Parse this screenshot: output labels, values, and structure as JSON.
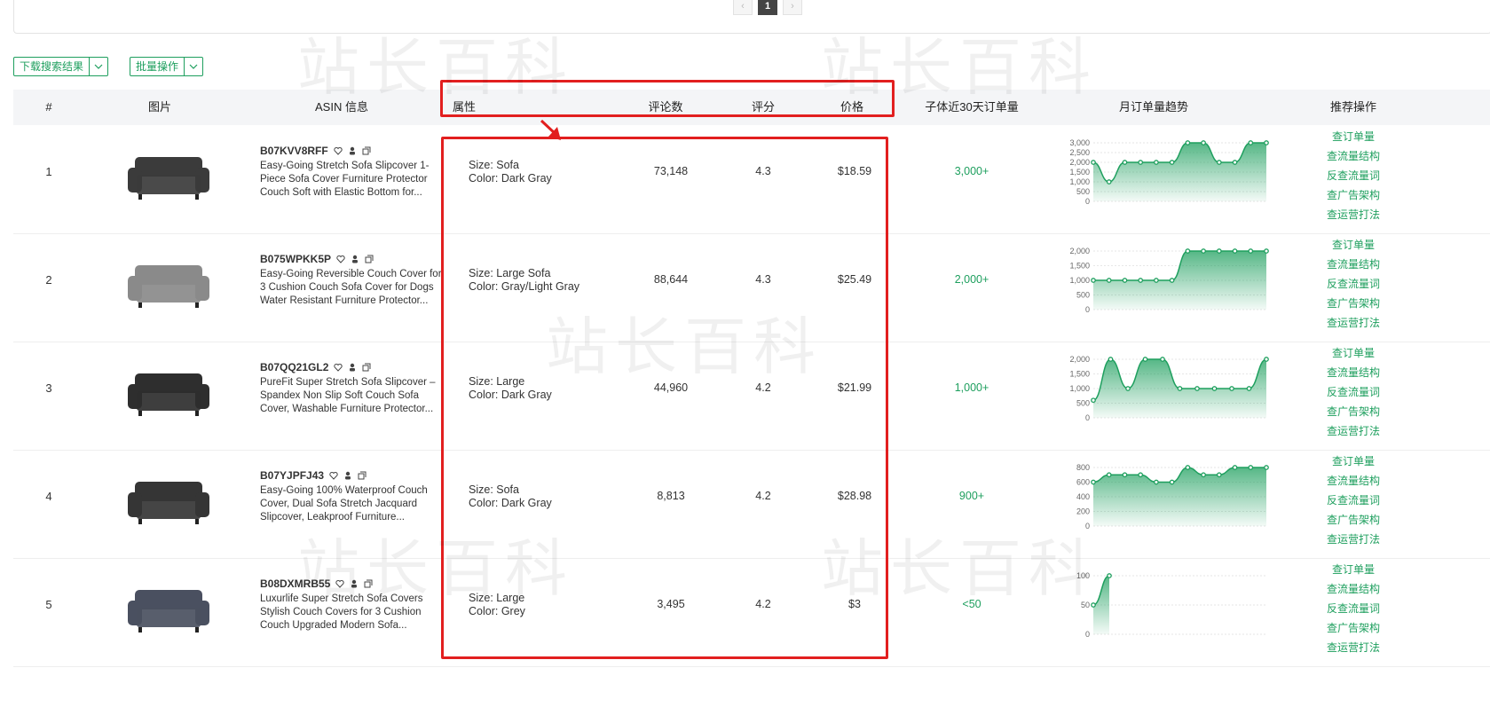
{
  "pager": {
    "prev": "‹",
    "current": "1",
    "next": "›"
  },
  "toolbar": {
    "download_label": "下载搜索结果",
    "batch_label": "批量操作"
  },
  "table": {
    "headers": {
      "index": "#",
      "image": "图片",
      "asin": "ASIN 信息",
      "attributes": "属性",
      "reviews": "评论数",
      "rating": "评分",
      "price": "价格",
      "orders": "子体近30天订单量",
      "trend": "月订单量趋势",
      "actions": "推荐操作"
    },
    "rows": [
      {
        "index": "1",
        "asin": "B07KVV8RFF",
        "title1": "Easy-Going Stretch Sofa Slipcover 1-",
        "title2": "Piece Sofa Cover Furniture Protector",
        "title3": "Couch Soft with Elastic Bottom for...",
        "size": "Size: Sofa",
        "color": "Color: Dark Gray",
        "reviews": "73,148",
        "rating": "4.3",
        "price": "$18.59",
        "orders": "3,000+",
        "trend": {
          "yticks": [
            "3,000",
            "2,500",
            "2,000",
            "1,500",
            "1,000",
            "500",
            "0"
          ],
          "ymax": 3000,
          "values": [
            2000,
            1000,
            2000,
            2000,
            2000,
            2000,
            3000,
            3000,
            2000,
            2000,
            3000,
            3000
          ]
        }
      },
      {
        "index": "2",
        "asin": "B075WPKK5P",
        "title1": "Easy-Going Reversible Couch Cover for",
        "title2": "3 Cushion Couch Sofa Cover for Dogs",
        "title3": "Water Resistant Furniture Protector...",
        "size": "Size: Large Sofa",
        "color": "Color: Gray/Light Gray",
        "reviews": "88,644",
        "rating": "4.3",
        "price": "$25.49",
        "orders": "2,000+",
        "trend": {
          "yticks": [
            "2,000",
            "1,500",
            "1,000",
            "500",
            "0"
          ],
          "ymax": 2000,
          "values": [
            1000,
            1000,
            1000,
            1000,
            1000,
            1000,
            2000,
            2000,
            2000,
            2000,
            2000,
            2000
          ]
        }
      },
      {
        "index": "3",
        "asin": "B07QQ21GL2",
        "title1": "PureFit Super Stretch Sofa Slipcover –",
        "title2": "Spandex Non Slip Soft Couch Sofa",
        "title3": "Cover, Washable Furniture Protector...",
        "size": "Size: Large",
        "color": "Color: Dark Gray",
        "reviews": "44,960",
        "rating": "4.2",
        "price": "$21.99",
        "orders": "1,000+",
        "trend": {
          "yticks": [
            "2,000",
            "1,500",
            "1,000",
            "500",
            "0"
          ],
          "ymax": 2000,
          "values": [
            600,
            2000,
            1000,
            2000,
            2000,
            1000,
            1000,
            1000,
            1000,
            1000,
            2000
          ]
        }
      },
      {
        "index": "4",
        "asin": "B07YJPFJ43",
        "title1": "Easy-Going 100% Waterproof Couch",
        "title2": "Cover, Dual Sofa Stretch Jacquard",
        "title3": "Slipcover, Leakproof Furniture...",
        "size": "Size: Sofa",
        "color": "Color: Dark Gray",
        "reviews": "8,813",
        "rating": "4.2",
        "price": "$28.98",
        "orders": "900+",
        "trend": {
          "yticks": [
            "800",
            "600",
            "400",
            "200",
            "0"
          ],
          "ymax": 800,
          "values": [
            600,
            700,
            700,
            700,
            600,
            600,
            800,
            700,
            700,
            800,
            800,
            800
          ]
        }
      },
      {
        "index": "5",
        "asin": "B08DXMRB55",
        "title1": "Luxurlife Super Stretch Sofa Covers",
        "title2": "Stylish Couch Covers for 3 Cushion",
        "title3": "Couch Upgraded Modern Sofa...",
        "size": "Size: Large",
        "color": "Color: Grey",
        "reviews": "3,495",
        "rating": "4.2",
        "price": "$3",
        "orders": "<50",
        "trend": {
          "yticks": [
            "100",
            "50",
            "0"
          ],
          "ymax": 100,
          "values": [
            50,
            100
          ]
        }
      }
    ],
    "actions": [
      "查订单量",
      "查流量结构",
      "反查流量词",
      "查广告架构",
      "查运营打法"
    ]
  },
  "colors": {
    "accent": "#1e9f5e",
    "highlight": "#e21f1f",
    "header_bg": "#f4f5f7"
  },
  "watermark": "站长百科"
}
